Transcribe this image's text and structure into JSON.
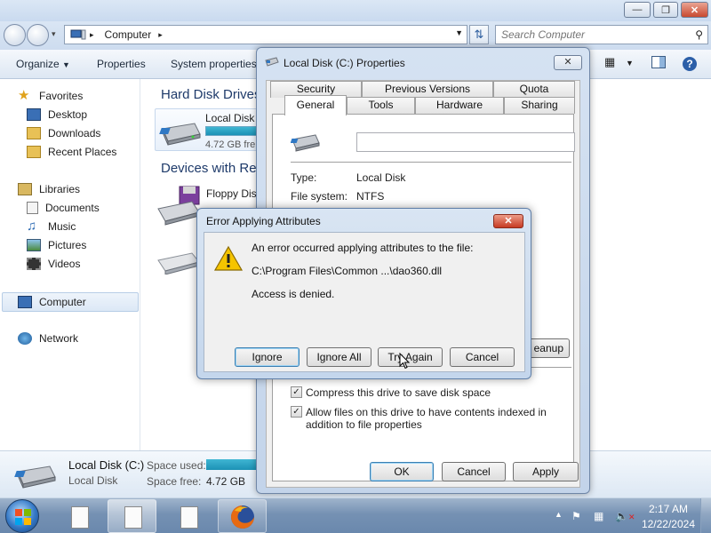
{
  "explorer": {
    "address": {
      "path": "Computer"
    },
    "search": {
      "placeholder": "Search Computer"
    },
    "toolbar": {
      "organize": "Organize",
      "properties": "Properties",
      "system_properties": "System properties"
    },
    "nav": {
      "favorites": "Favorites",
      "desktop": "Desktop",
      "downloads": "Downloads",
      "recent_places": "Recent Places",
      "libraries": "Libraries",
      "documents": "Documents",
      "music": "Music",
      "pictures": "Pictures",
      "videos": "Videos",
      "computer": "Computer",
      "network": "Network"
    },
    "content": {
      "hard_disk_heading": "Hard Disk Drives",
      "devices_heading": "Devices with Re",
      "drive_label": "Local Disk",
      "drive_free": "4.72 GB fre",
      "floppy_label": "Floppy Disk"
    },
    "details": {
      "name": "Local Disk (C:)",
      "type": "Local Disk",
      "space_used_label": "Space used:",
      "space_free_label": "Space free:",
      "space_free_value": "4.72 GB"
    }
  },
  "properties": {
    "title": "Local Disk (C:) Properties",
    "tabs_back": [
      "Security",
      "Previous Versions",
      "Quota"
    ],
    "tabs_front": [
      "General",
      "Tools",
      "Hardware",
      "Sharing"
    ],
    "type_label": "Type:",
    "type_value": "Local Disk",
    "fs_label": "File system:",
    "fs_value": "NTFS",
    "cleanup_partial": "eanup",
    "compress_label": "Compress this drive to save disk space",
    "compress_checked": true,
    "index_label": "Allow files on this drive to have contents indexed in addition to file properties",
    "index_checked": true,
    "buttons": {
      "ok": "OK",
      "cancel": "Cancel",
      "apply": "Apply"
    }
  },
  "error_dialog": {
    "title": "Error Applying Attributes",
    "message": "An error occurred applying attributes to the file:",
    "file": "C:\\Program Files\\Common ...\\dao360.dll",
    "reason": "Access is denied.",
    "buttons": {
      "ignore": "Ignore",
      "ignore_all": "Ignore All",
      "try_again": "Try Again",
      "cancel": "Cancel"
    }
  },
  "taskbar": {
    "time": "2:17 AM",
    "date": "12/22/2024"
  }
}
